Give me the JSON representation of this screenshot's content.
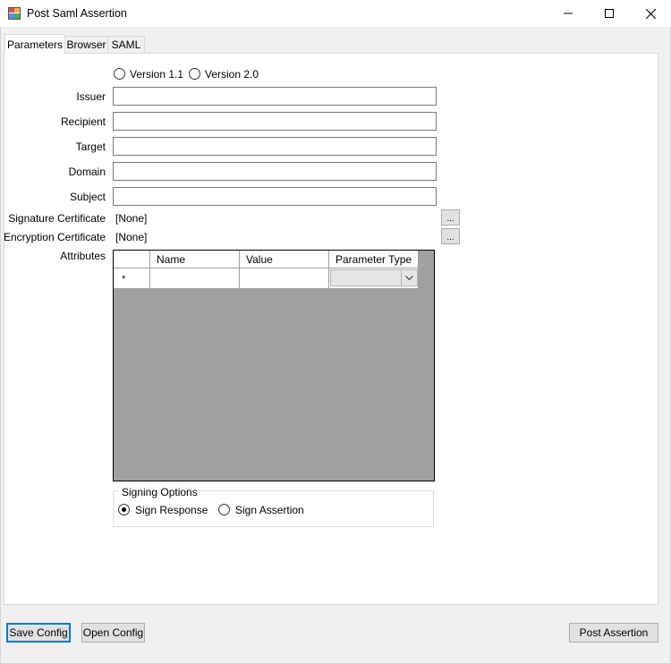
{
  "window": {
    "title": "Post Saml Assertion",
    "minimize_glyph": "—",
    "maximize_glyph": "☐",
    "close_glyph": "✕"
  },
  "tabs": [
    {
      "label": "Parameters",
      "selected": true
    },
    {
      "label": "Browser",
      "selected": false
    },
    {
      "label": "SAML",
      "selected": false
    }
  ],
  "version": {
    "options": [
      {
        "label": "Version 1.1",
        "checked": false
      },
      {
        "label": "Version 2.0",
        "checked": false
      }
    ]
  },
  "fields": {
    "issuer": {
      "label": "Issuer",
      "value": ""
    },
    "recipient": {
      "label": "Recipient",
      "value": ""
    },
    "target": {
      "label": "Target",
      "value": ""
    },
    "domain": {
      "label": "Domain",
      "value": ""
    },
    "subject": {
      "label": "Subject",
      "value": ""
    }
  },
  "certificates": {
    "signature": {
      "label": "Signature Certificate",
      "value": "[None]",
      "browse_label": "..."
    },
    "encryption": {
      "label": "Encryption Certificate",
      "value": "[None]",
      "browse_label": "..."
    }
  },
  "attributes": {
    "label": "Attributes",
    "columns": [
      "",
      "Name",
      "Value",
      "Parameter Type"
    ],
    "new_row_marker": "*"
  },
  "signing_options": {
    "legend": "Signing Options",
    "options": [
      {
        "label": "Sign Response",
        "checked": true
      },
      {
        "label": "Sign Assertion",
        "checked": false
      }
    ]
  },
  "buttons": {
    "save_config": "Save Config",
    "open_config": "Open Config",
    "post_assertion": "Post Assertion"
  },
  "colors": {
    "focus_border": "#0078d7",
    "grid_background": "#a0a0a0"
  }
}
